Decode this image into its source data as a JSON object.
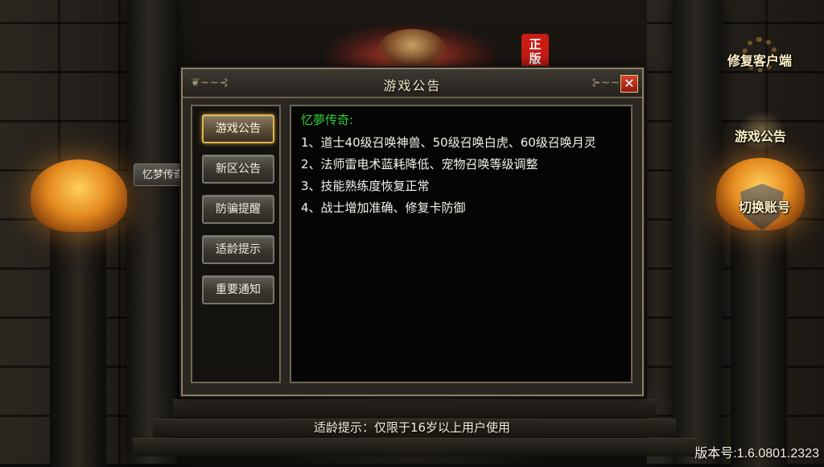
{
  "background": {
    "banner_badge": "正\n版"
  },
  "side_tag": {
    "label": "忆梦传奇"
  },
  "side_buttons": {
    "repair_client": "修复客户端",
    "game_notice": "游戏公告",
    "switch_account": "切换账号"
  },
  "dialog": {
    "title": "游戏公告",
    "close_label": "✕",
    "tabs": [
      {
        "label": "游戏公告",
        "active": true
      },
      {
        "label": "新区公告",
        "active": false
      },
      {
        "label": "防骗提醒",
        "active": false
      },
      {
        "label": "适龄提示",
        "active": false
      },
      {
        "label": "重要通知",
        "active": false
      }
    ],
    "content": {
      "heading": "忆夢传奇:",
      "lines": [
        "1、道士40级召唤神兽、50级召唤白虎、60级召唤月灵",
        "2、法师雷电术蓝耗降低、宠物召唤等级调整",
        "3、技能熟练度恢复正常",
        "4、战士增加准确、修复卡防御"
      ]
    }
  },
  "footer": {
    "age_tip": "适龄提示：仅限于16岁以上用户使用",
    "version": "版本号:1.6.0801.2323"
  },
  "colors": {
    "heading_green": "#2fd12f",
    "active_tab_border": "#e0b54c",
    "close_red": "#c0301e"
  }
}
